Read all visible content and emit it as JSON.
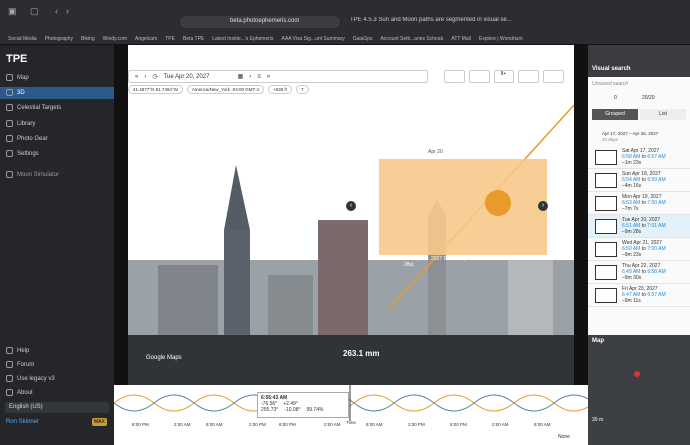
{
  "browser": {
    "url": "beta.photoephemeris.com",
    "tab2": "TPE 4.5.3 Sun and Moon paths are segmented in visual se..."
  },
  "bookmarks": [
    "Social Media",
    "Photography",
    "Biking",
    "Windy.com",
    "Angelcam",
    "TPE",
    "Beta TPE",
    "Latest Inside...'s Ephemeris",
    "AAA Visa Sig...unt Summary",
    "GaiaGps",
    "Account Setti...aries Scheab",
    "ATT Mail",
    "Explore | Wondrium"
  ],
  "sidebar": {
    "brand": "TPE",
    "items": [
      "Map",
      "3D",
      "Celestial Targets",
      "Library",
      "Photo Gear",
      "Settings",
      "Moon Simulator"
    ],
    "bottom": [
      "Help",
      "Forum",
      "Use legacy v3",
      "About"
    ],
    "language": "English (US)",
    "user": "Ron Skinner",
    "plan": "MAX"
  },
  "toolbar": {
    "date": "Tue Apr 20, 2027",
    "mode": "8+"
  },
  "coords": {
    "latlon": "41.4877°N 81.7494°W",
    "tz": "America/New_York -04:00 GMT-4",
    "elev": "+638 ft",
    "t": "T"
  },
  "photo": {
    "focal": "263.1 mm",
    "google": "Google Maps",
    "sun_label": "Tue Apr 20, 2027 6:51 AM (-9m 28s)",
    "box_label": "Apr 20"
  },
  "chart": {
    "time": "6:56:43 AM",
    "r1a": "-76.56°",
    "r1b": "+2.49°",
    "r2a": "255.73°",
    "r2b": "-10.08°",
    "r2c": "99.74%",
    "axis": [
      "8:00 PM",
      "2:00 AM",
      "8:00 AM",
      "2:00 PM",
      "8:00 PM",
      "2:00 AM",
      "8:00 AM",
      "2:00 PM",
      "8:00 PM",
      "2:00 AM",
      "8:00 AM"
    ],
    "time_label": "Time",
    "none": "None"
  },
  "right": {
    "title": "Visual search",
    "unsaved": "Unsaved search",
    "count": "20/20",
    "zero": "0",
    "tabs": [
      "Grouped",
      "List"
    ],
    "range": "Apr 17, 2027 – Apr 26, 2027",
    "days": "10 days",
    "rows": [
      {
        "date": "Sat Apr 17, 2027",
        "t1": "6:58 AM",
        "t2": "6:57 AM",
        "d": "–1m 23s"
      },
      {
        "date": "Sun Apr 18, 2027",
        "t1": "6:54 AM",
        "t2": "6:59 AM",
        "d": "–4m 16s"
      },
      {
        "date": "Mon Apr 19, 2027",
        "t1": "6:53 AM",
        "t2": "7:00 AM",
        "d": "–7m 7s"
      },
      {
        "date": "Tue Apr 20, 2027",
        "t1": "6:51 AM",
        "t2": "7:01 AM",
        "d": "–9m 28s"
      },
      {
        "date": "Wed Apr 21, 2027",
        "t1": "6:50 AM",
        "t2": "7:00 AM",
        "d": "–9m 23s"
      },
      {
        "date": "Thu Apr 22, 2027",
        "t1": "6:49 AM",
        "t2": "6:58 AM",
        "d": "–9m 30s"
      },
      {
        "date": "Fri Apr 23, 2027",
        "t1": "6:47 AM",
        "t2": "6:57 AM",
        "d": "–9m 11s"
      }
    ],
    "map_title": "Map",
    "map_scale": "30 m"
  }
}
